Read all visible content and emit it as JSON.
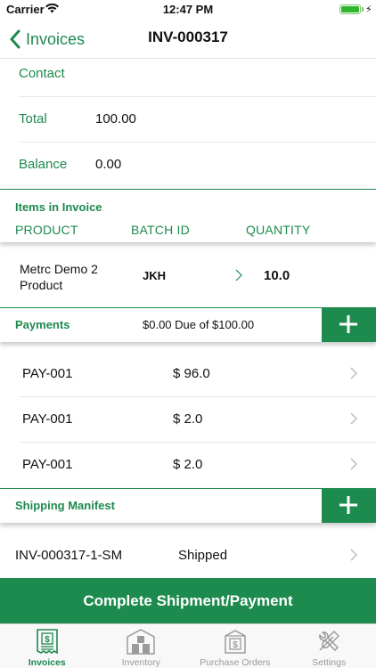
{
  "status_bar": {
    "carrier": "Carrier",
    "time": "12:47 PM"
  },
  "nav": {
    "back_label": "Invoices",
    "title": "INV-000317"
  },
  "details": [
    {
      "label": "Contact",
      "value": ""
    },
    {
      "label": "Total",
      "value": "100.00"
    },
    {
      "label": "Balance",
      "value": "0.00"
    }
  ],
  "items_section": {
    "title": "Items in Invoice",
    "columns": [
      "PRODUCT",
      "BATCH ID",
      "QUANTITY"
    ],
    "rows": [
      {
        "product": "Metrc Demo 2 Product",
        "batch_id": "JKH",
        "quantity": "10.0"
      }
    ]
  },
  "payments_section": {
    "title": "Payments",
    "due_text": "$0.00 Due of $100.00",
    "rows": [
      {
        "id": "PAY-001",
        "amount": "$ 96.0"
      },
      {
        "id": "PAY-001",
        "amount": "$ 2.0"
      },
      {
        "id": "PAY-001",
        "amount": "$ 2.0"
      }
    ]
  },
  "shipping_section": {
    "title": "Shipping Manifest",
    "rows": [
      {
        "id": "INV-000317-1-SM",
        "status": "Shipped"
      }
    ]
  },
  "complete_button_label": "Complete Shipment/Payment",
  "tabs": [
    {
      "label": "Invoices",
      "icon": "invoice-icon",
      "active": true
    },
    {
      "label": "Inventory",
      "icon": "inventory-icon",
      "active": false
    },
    {
      "label": "Purchase Orders",
      "icon": "purchase-orders-icon",
      "active": false
    },
    {
      "label": "Settings",
      "icon": "settings-icon",
      "active": false
    }
  ],
  "colors": {
    "accent": "#1d8a4e",
    "inactive": "#9a9a9a",
    "divider": "#e6e6e6"
  }
}
